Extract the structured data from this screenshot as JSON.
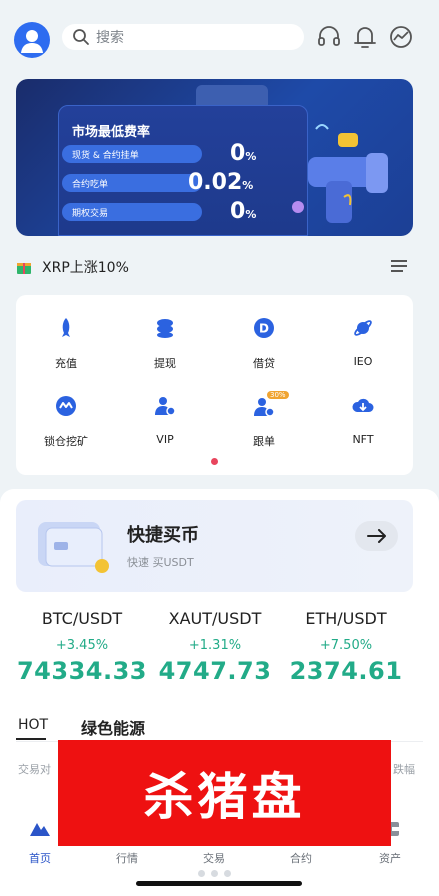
{
  "search": {
    "placeholder": "搜索"
  },
  "banner": {
    "title": "市场最低费率",
    "rows": [
      {
        "label": "现货 & 合约挂单",
        "value": "0",
        "unit": "%"
      },
      {
        "label": "合约吃单",
        "value": "0.02",
        "unit": "%"
      },
      {
        "label": "期权交易",
        "value": "0",
        "unit": "%"
      }
    ]
  },
  "ticker": {
    "text": "XRP上涨10%"
  },
  "menu": {
    "items": [
      {
        "label": "充值",
        "icon": "rocket-icon"
      },
      {
        "label": "提现",
        "icon": "coins-icon"
      },
      {
        "label": "借贷",
        "icon": "dollar-coin-icon"
      },
      {
        "label": "IEO",
        "icon": "planet-icon"
      },
      {
        "label": "锁仓挖矿",
        "icon": "mining-icon"
      },
      {
        "label": "VIP",
        "icon": "vip-user-icon"
      },
      {
        "label": "跟单",
        "icon": "copy-trade-icon",
        "badge": "30%"
      },
      {
        "label": "NFT",
        "icon": "nft-cloud-icon"
      }
    ]
  },
  "buy": {
    "title": "快捷买币",
    "subtitle": "快速 买USDT"
  },
  "markets": [
    {
      "pair": "BTC/USDT",
      "change": "+3.45%",
      "price": "74334.33"
    },
    {
      "pair": "XAUT/USDT",
      "change": "+1.31%",
      "price": "4747.73"
    },
    {
      "pair": "ETH/USDT",
      "change": "+7.50%",
      "price": "2374.61"
    }
  ],
  "tabs": {
    "hot": "HOT",
    "green": "绿色能源"
  },
  "table": {
    "col_left": "交易对",
    "col_right": "跌幅"
  },
  "overlay": {
    "text": "杀猪盘"
  },
  "nav": {
    "items": [
      {
        "label": "首页",
        "active": true
      },
      {
        "label": "行情"
      },
      {
        "label": "交易"
      },
      {
        "label": "合约"
      },
      {
        "label": "资产"
      }
    ]
  },
  "colors": {
    "accent": "#2b55c8",
    "up": "#22ab88",
    "overlay": "#ee1111"
  }
}
